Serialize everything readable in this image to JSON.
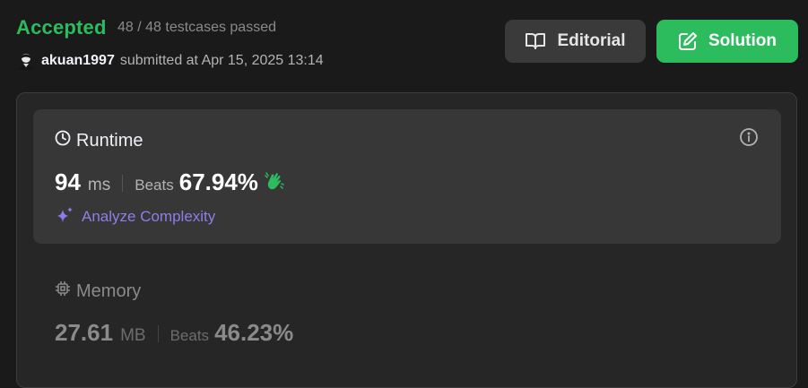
{
  "status": {
    "title": "Accepted",
    "testcases": "48 / 48 testcases passed",
    "color": "#2cbb5d"
  },
  "submission": {
    "username": "akuan1997",
    "submitted_text": "submitted at Apr 15, 2025 13:14"
  },
  "buttons": {
    "editorial": {
      "label": "Editorial",
      "icon": "book-open-icon"
    },
    "solution": {
      "label": "Solution",
      "icon": "edit-icon"
    }
  },
  "runtime": {
    "label": "Runtime",
    "value": "94",
    "unit": "ms",
    "beats_label": "Beats",
    "beats_value": "67.94%",
    "analyze_label": "Analyze Complexity"
  },
  "memory": {
    "label": "Memory",
    "value": "27.61",
    "unit": "MB",
    "beats_label": "Beats",
    "beats_value": "46.23%"
  },
  "colors": {
    "accent_green": "#2cbb5d",
    "analyze_purple": "#8c7fe8",
    "background": "#1a1a1a"
  }
}
